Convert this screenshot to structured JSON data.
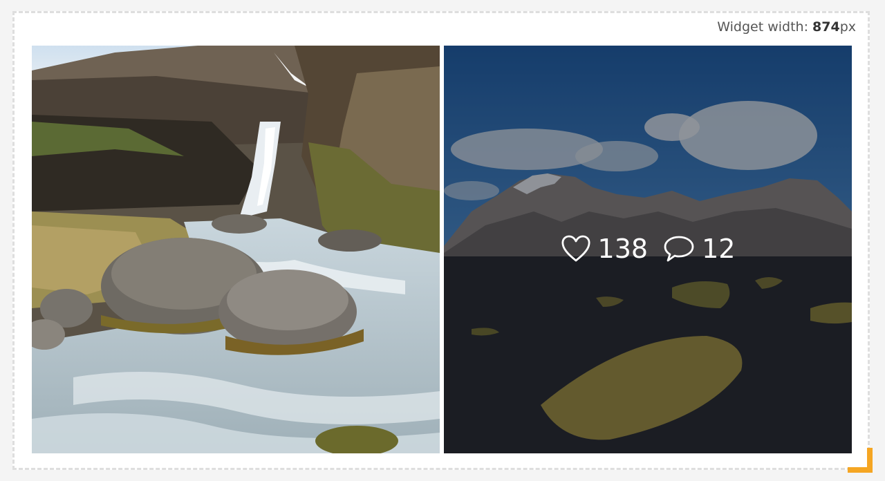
{
  "widget": {
    "width_label": "Widget width: ",
    "width_value": "874",
    "width_unit": "px"
  },
  "posts": [
    {
      "image": "waterfall-photo"
    },
    {
      "image": "mountain-black-sand-photo",
      "likes": "138",
      "comments": "12"
    }
  ],
  "icons": {
    "like": "heart-icon",
    "comment": "comment-bubble-icon",
    "resize": "resize-handle-icon"
  },
  "colors": {
    "accent": "#f5a623",
    "frame_border": "#dedede",
    "overlay": "rgba(10,14,24,0.42)"
  }
}
